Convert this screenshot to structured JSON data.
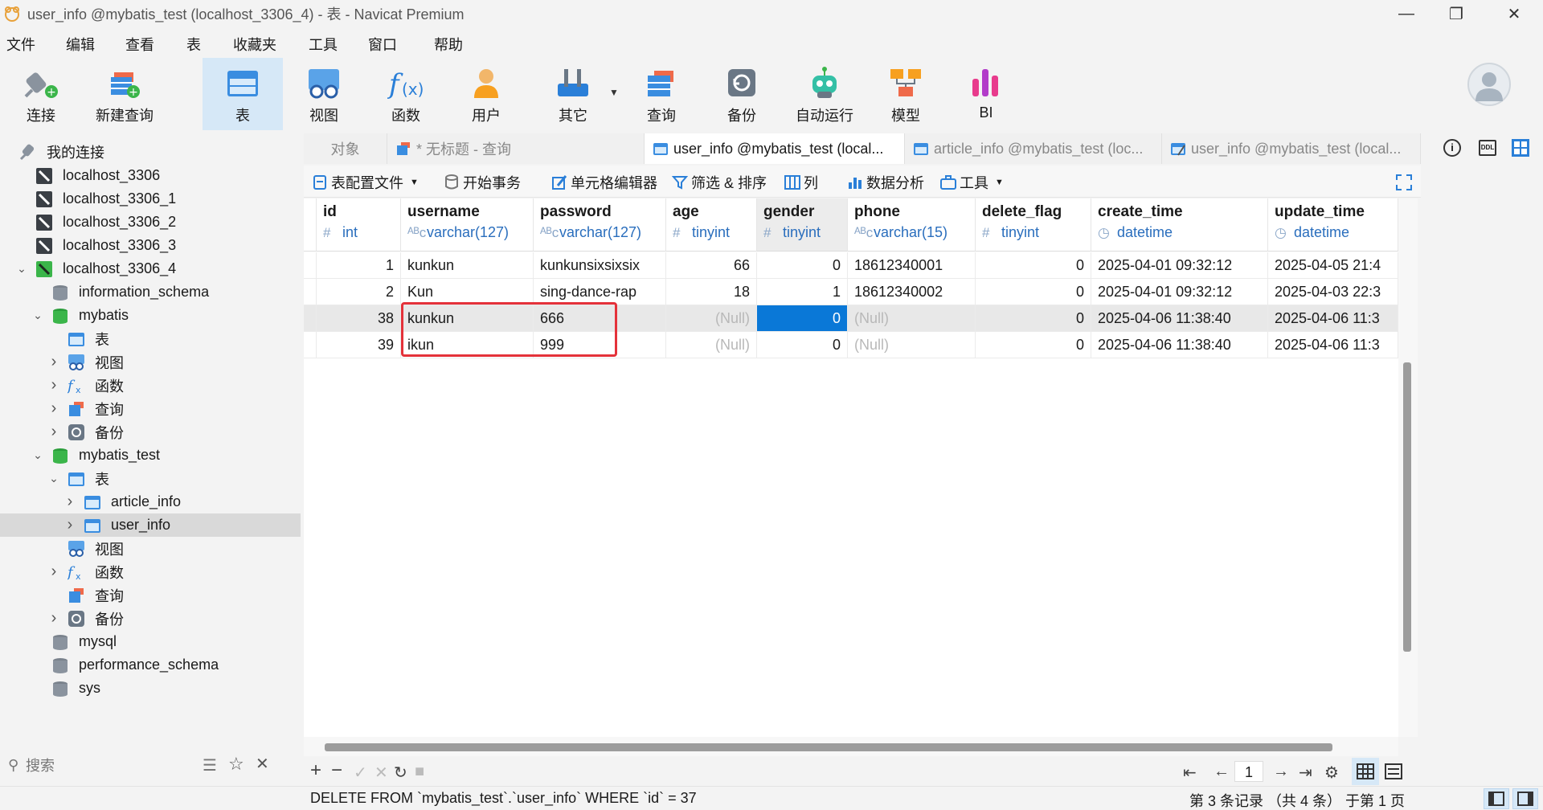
{
  "window": {
    "title": "user_info @mybatis_test (localhost_3306_4) - 表 - Navicat Premium",
    "minimize": "—",
    "maximize": "❐",
    "close": "✕"
  },
  "menu": [
    "文件",
    "编辑",
    "查看",
    "表",
    "收藏夹",
    "工具",
    "窗口",
    "帮助"
  ],
  "toolbar": [
    {
      "label": "连接",
      "icon": "plug-connect-icon"
    },
    {
      "label": "新建查询",
      "icon": "new-query-icon"
    },
    {
      "label": "表",
      "icon": "table-icon",
      "active": true
    },
    {
      "label": "视图",
      "icon": "view-glasses-icon"
    },
    {
      "label": "函数",
      "icon": "function-fx-icon"
    },
    {
      "label": "用户",
      "icon": "user-icon"
    },
    {
      "label": "其它",
      "icon": "tools-icon"
    },
    {
      "label": "查询",
      "icon": "query-icon"
    },
    {
      "label": "备份",
      "icon": "backup-icon"
    },
    {
      "label": "自动运行",
      "icon": "robot-icon"
    },
    {
      "label": "模型",
      "icon": "model-icon"
    },
    {
      "label": "BI",
      "icon": "bi-icon"
    }
  ],
  "sidebar": {
    "header": "我的连接",
    "items": [
      {
        "label": "localhost_3306"
      },
      {
        "label": "localhost_3306_1"
      },
      {
        "label": "localhost_3306_2"
      },
      {
        "label": "localhost_3306_3"
      },
      {
        "label": "localhost_3306_4"
      },
      {
        "label": "information_schema"
      },
      {
        "label": "mybatis"
      },
      {
        "label": "表"
      },
      {
        "label": "视图"
      },
      {
        "label": "函数"
      },
      {
        "label": "查询"
      },
      {
        "label": "备份"
      },
      {
        "label": "mybatis_test"
      },
      {
        "label": "表"
      },
      {
        "label": "article_info"
      },
      {
        "label": "user_info"
      },
      {
        "label": "视图"
      },
      {
        "label": "函数"
      },
      {
        "label": "查询"
      },
      {
        "label": "备份"
      },
      {
        "label": "mysql"
      },
      {
        "label": "performance_schema"
      },
      {
        "label": "sys"
      }
    ],
    "search_placeholder": "搜索"
  },
  "tabs": [
    {
      "label": "对象"
    },
    {
      "label": "* 无标题 - 查询"
    },
    {
      "label": "user_info @mybatis_test (local...",
      "active": true
    },
    {
      "label": "article_info @mybatis_test (loc..."
    },
    {
      "label": "user_info @mybatis_test (local..."
    }
  ],
  "subtoolbar": {
    "table_config": "表配置文件",
    "begin_tx": "开始事务",
    "cell_editor": "单元格编辑器",
    "filter_sort": "筛选 & 排序",
    "columns": "列",
    "data_analysis": "数据分析",
    "tools": "工具"
  },
  "grid": {
    "columns": [
      {
        "name": "id",
        "type": "int",
        "glyph": "#"
      },
      {
        "name": "username",
        "type": "varchar(127)",
        "glyph": "ᴬᴮc"
      },
      {
        "name": "password",
        "type": "varchar(127)",
        "glyph": "ᴬᴮc"
      },
      {
        "name": "age",
        "type": "tinyint",
        "glyph": "#"
      },
      {
        "name": "gender",
        "type": "tinyint",
        "glyph": "#"
      },
      {
        "name": "phone",
        "type": "varchar(15)",
        "glyph": "ᴬᴮc"
      },
      {
        "name": "delete_flag",
        "type": "tinyint",
        "glyph": "#"
      },
      {
        "name": "create_time",
        "type": "datetime",
        "glyph": "◷"
      },
      {
        "name": "update_time",
        "type": "datetime",
        "glyph": "◷"
      }
    ],
    "rows": [
      [
        "1",
        "kunkun",
        "kunkunsixsixsix",
        "66",
        "0",
        "18612340001",
        "0",
        "2025-04-01 09:32:12",
        "2025-04-05 21:4"
      ],
      [
        "2",
        "Kun",
        "sing-dance-rap",
        "18",
        "1",
        "18612340002",
        "0",
        "2025-04-01 09:32:12",
        "2025-04-03 22:3"
      ],
      [
        "38",
        "kunkun",
        "666",
        "(Null)",
        "0",
        "(Null)",
        "0",
        "2025-04-06 11:38:40",
        "2025-04-06 11:3"
      ],
      [
        "39",
        "ikun",
        "999",
        "(Null)",
        "0",
        "(Null)",
        "0",
        "2025-04-06 11:38:40",
        "2025-04-06 11:3"
      ]
    ],
    "highlighted_row": 2,
    "selected_cell": [
      2,
      4
    ]
  },
  "pager": {
    "page": "1"
  },
  "status": {
    "sql": "DELETE FROM `mybatis_test`.`user_info` WHERE `id` = 37",
    "record": "第 3 条记录 （共 4 条） 于第 1 页"
  }
}
